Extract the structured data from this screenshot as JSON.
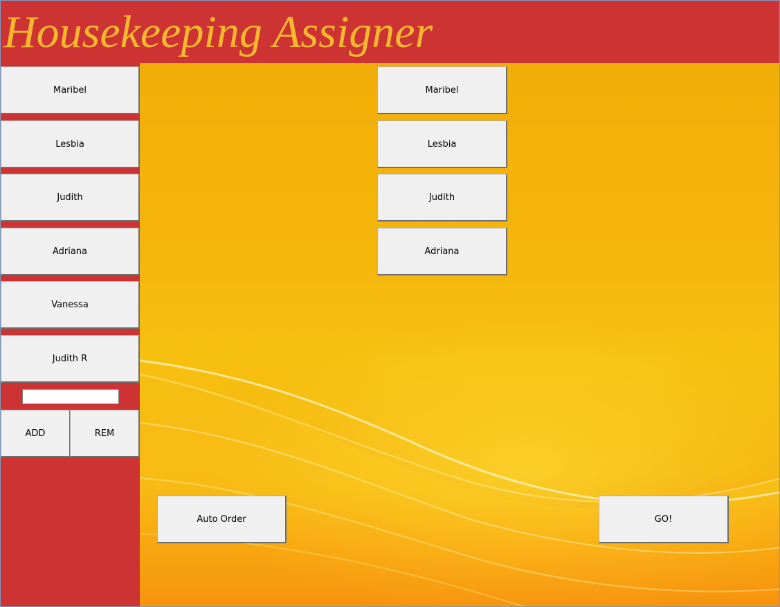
{
  "app": {
    "title": "Housekeeping Assigner"
  },
  "sidebar": {
    "staff": [
      "Maribel",
      "Lesbia",
      "Judith",
      "Adriana",
      "Vanessa",
      "Judith R"
    ],
    "name_input_value": "",
    "add_label": "ADD",
    "remove_label": "REM"
  },
  "main": {
    "assigned": [
      "Maribel",
      "Lesbia",
      "Judith",
      "Adriana"
    ],
    "auto_order_label": "Auto Order",
    "go_label": "GO!"
  },
  "colors": {
    "header": "#cd3333",
    "title_text": "#f5b82e",
    "background_top": "#f2ae08",
    "background_bottom": "#ef8a0c",
    "button_face": "#f0f0f0"
  }
}
